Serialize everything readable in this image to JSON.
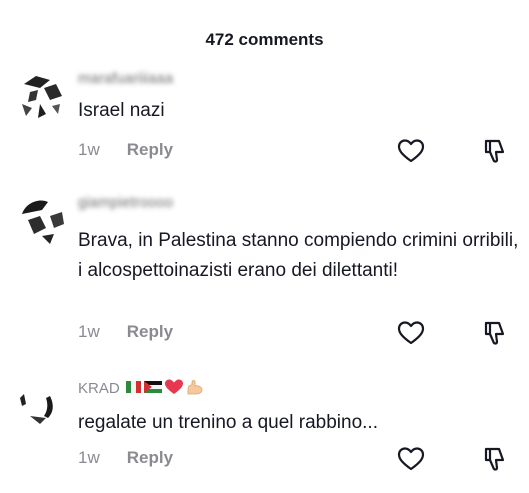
{
  "header": {
    "title": "472 comments"
  },
  "comments": [
    {
      "username": "marafuariiiaaa",
      "text": "Israel nazi",
      "time": "1w",
      "reply": "Reply"
    },
    {
      "username": "giampietroooo",
      "text": "Brava, in Palestina stanno compiendo crimini orribili, i alcospettoinazisti erano dei dilettanti!",
      "time": "1w",
      "reply": "Reply"
    },
    {
      "username": "KRAD",
      "username_emojis": [
        "italy-flag",
        "palestine-flag",
        "red-heart",
        "flexed-biceps"
      ],
      "text": "regalate un trenino a quel rabbino...",
      "time": "1w",
      "reply": "Reply"
    }
  ],
  "icons": {
    "like": "heart-outline-icon",
    "dislike": "thumbs-down-outline-icon"
  },
  "colors": {
    "text": "#161823",
    "meta": "#8a8b91",
    "heart": "#e8384f"
  }
}
